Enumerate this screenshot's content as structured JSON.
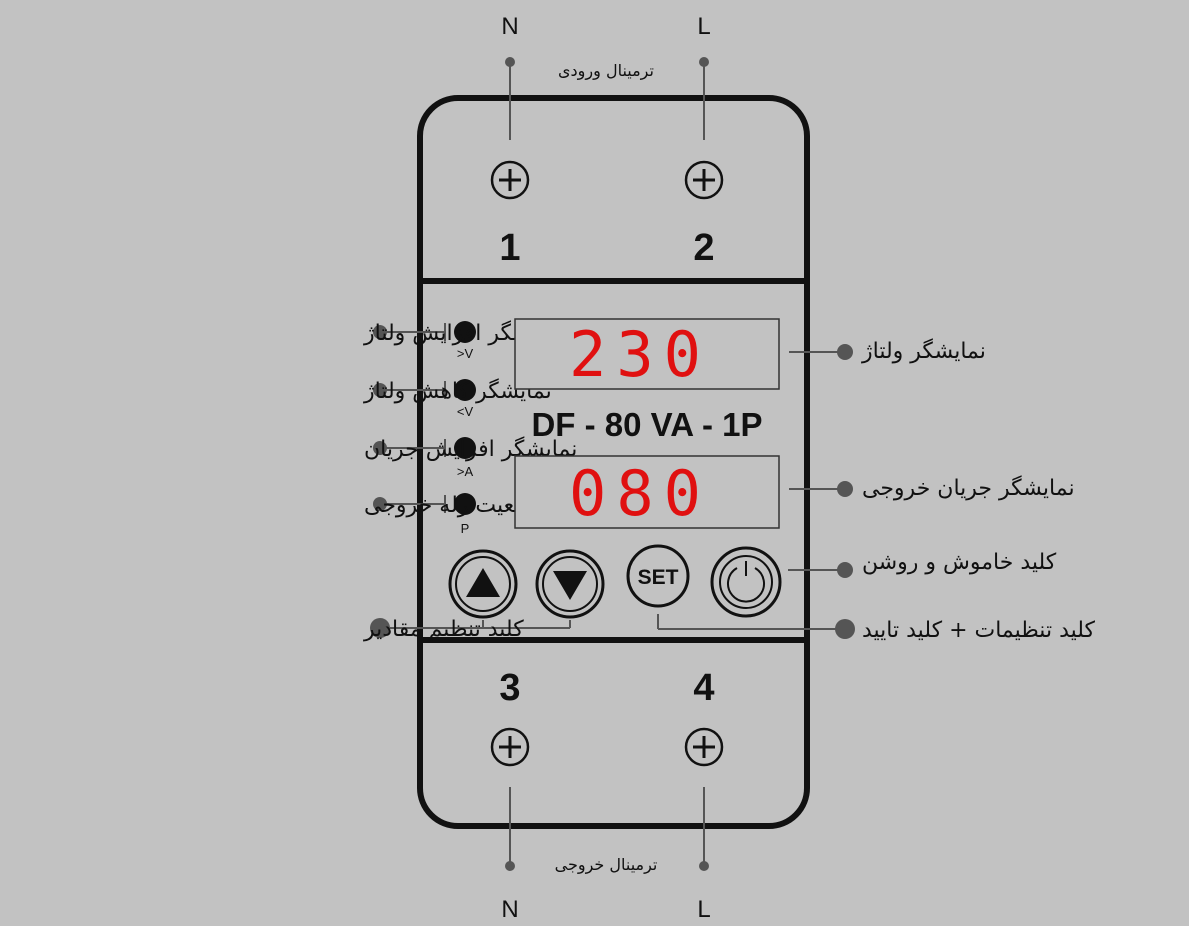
{
  "top_terminal": {
    "title": "ترمینال ورودی",
    "left_label": "N",
    "right_label": "L",
    "left_number": "1",
    "right_number": "2"
  },
  "bottom_terminal": {
    "title": "ترمینال خروجی",
    "left_label": "N",
    "right_label": "L",
    "left_number": "3",
    "right_number": "4"
  },
  "displays": {
    "voltage_value": "230",
    "current_value": "080",
    "model": "DF - 80 VA - 1P"
  },
  "leds": [
    {
      "code": ">V",
      "label": "نمایشگر افزایش ولتاژ"
    },
    {
      "code": "<V",
      "label": "نمایشگر کاهش ولتاژ"
    },
    {
      "code": ">A",
      "label": "نمایشگر افزایش جریان"
    },
    {
      "code": "P",
      "label": "نمایشگر وضعیت رله خروجی"
    }
  ],
  "right_labels": {
    "voltage_display": "نمایشگر ولتاژ",
    "current_display": "نمایشگر جریان خروجی",
    "power_key": "کلید خاموش و روشن",
    "set_key": "کلید تنظیمات + کلید تایید"
  },
  "left_labels": {
    "adjust_keys": "کلید تنظیم مقادیر"
  },
  "buttons": {
    "set_label": "SET"
  },
  "colors": {
    "background": "#c2c2c2",
    "device_outline": "#111111",
    "display_digits": "#e01010",
    "leader_line": "#555555"
  }
}
